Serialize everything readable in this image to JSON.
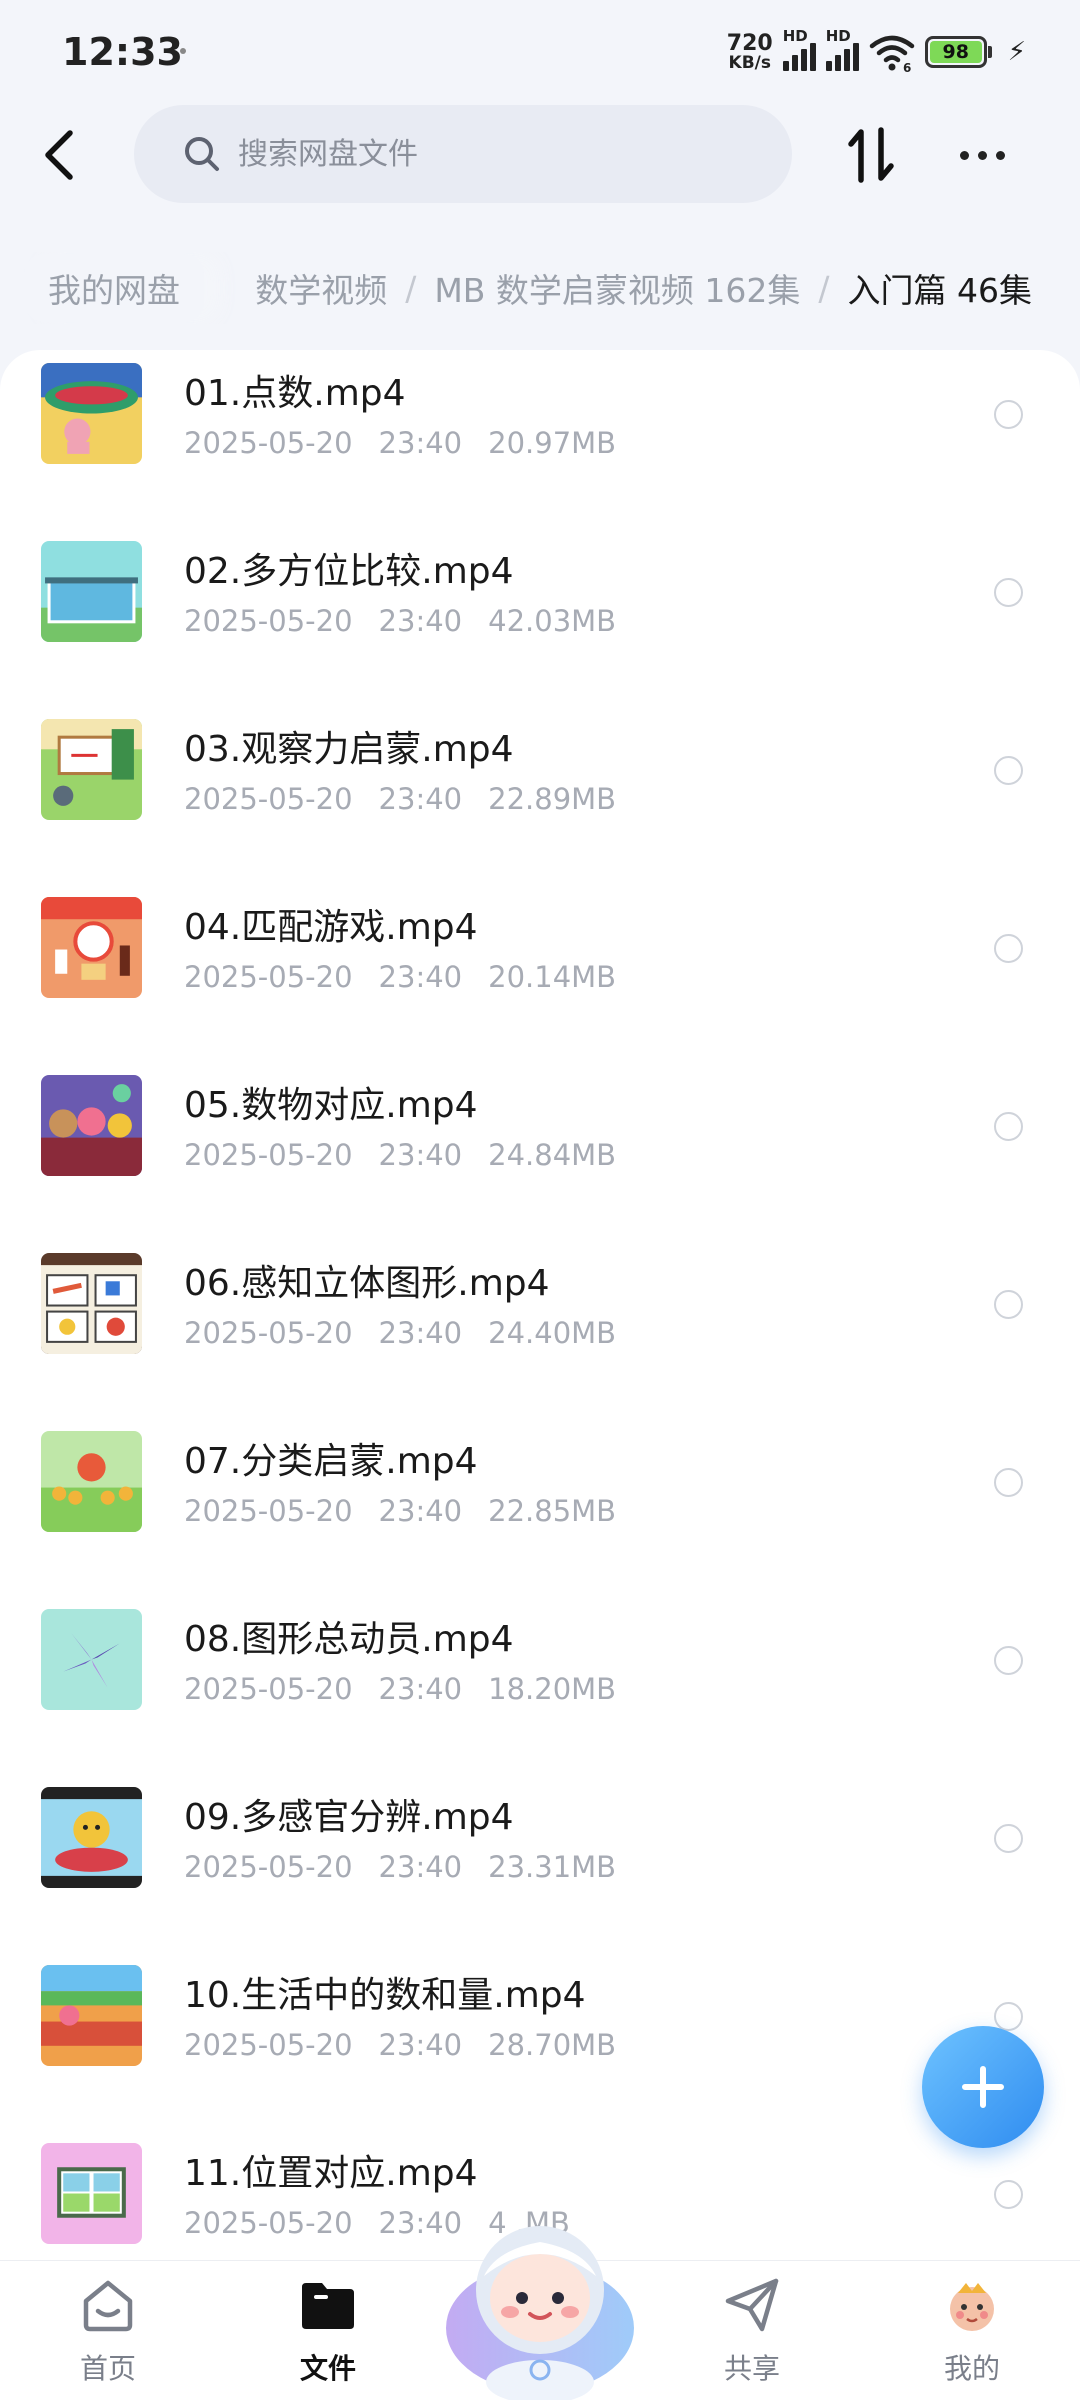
{
  "status_bar": {
    "time": "12:33",
    "net_speed_value": "720",
    "net_speed_unit": "KB/s",
    "sim1_label": "HD",
    "sim2_label": "HD",
    "battery": "98"
  },
  "header": {
    "search_placeholder": "搜索网盘文件"
  },
  "breadcrumb": {
    "root": "我的网盘",
    "items": [
      "数学视频",
      "MB 数学启蒙视频 162集",
      "入门篇 46集"
    ],
    "separator": "/"
  },
  "files": [
    {
      "name": "01.点数.mp4",
      "date": "2025-05-20",
      "time": "23:40",
      "size": "20.97MB"
    },
    {
      "name": "02.多方位比较.mp4",
      "date": "2025-05-20",
      "time": "23:40",
      "size": "42.03MB"
    },
    {
      "name": "03.观察力启蒙.mp4",
      "date": "2025-05-20",
      "time": "23:40",
      "size": "22.89MB"
    },
    {
      "name": "04.匹配游戏.mp4",
      "date": "2025-05-20",
      "time": "23:40",
      "size": "20.14MB"
    },
    {
      "name": "05.数物对应.mp4",
      "date": "2025-05-20",
      "time": "23:40",
      "size": "24.84MB"
    },
    {
      "name": "06.感知立体图形.mp4",
      "date": "2025-05-20",
      "time": "23:40",
      "size": "24.40MB"
    },
    {
      "name": "07.分类启蒙.mp4",
      "date": "2025-05-20",
      "time": "23:40",
      "size": "22.85MB"
    },
    {
      "name": "08.图形总动员.mp4",
      "date": "2025-05-20",
      "time": "23:40",
      "size": "18.20MB"
    },
    {
      "name": "09.多感官分辨.mp4",
      "date": "2025-05-20",
      "time": "23:40",
      "size": "23.31MB"
    },
    {
      "name": "10.生活中的数和量.mp4",
      "date": "2025-05-20",
      "time": "23:40",
      "size": "28.70MB"
    },
    {
      "name": "11.位置对应.mp4",
      "date": "2025-05-20",
      "time": "23:40",
      "size": "4 .MB"
    }
  ],
  "bottom_nav": {
    "home": "首页",
    "files": "文件",
    "share": "共享",
    "mine": "我的"
  },
  "colors": {
    "accent": "#2f8cf0",
    "background": "#f3f5fa",
    "text_secondary": "#a7abb4"
  }
}
